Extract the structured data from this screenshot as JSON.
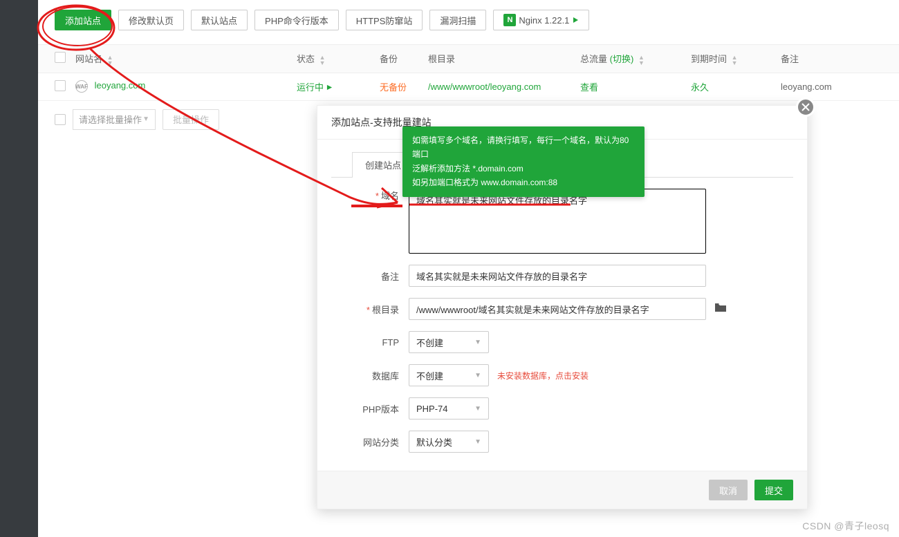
{
  "toolbar": {
    "add_site": "添加站点",
    "edit_default": "修改默认页",
    "default_site": "默认站点",
    "php_cli": "PHP命令行版本",
    "https_defense": "HTTPS防窜站",
    "vuln_scan": "漏洞扫描",
    "nginx": "Nginx 1.22.1"
  },
  "columns": {
    "name": "网站名",
    "status": "状态",
    "backup": "备份",
    "root": "根目录",
    "traffic_prefix": "总流量",
    "traffic_switch": "(切换)",
    "expire": "到期时间",
    "remark": "备注"
  },
  "row": {
    "name": "leoyang.com",
    "status": "运行中",
    "backup": "无备份",
    "root": "/www/wwwroot/leoyang.com",
    "traffic": "查看",
    "expire": "永久",
    "remark": "leoyang.com"
  },
  "batch": {
    "placeholder": "请选择批量操作",
    "action": "批量操作"
  },
  "modal": {
    "title": "添加站点-支持批量建站",
    "tab": "创建站点",
    "tooltip": {
      "l1": "如需填写多个域名，请换行填写，每行一个域名，默认为80端口",
      "l2": "泛解析添加方法 *.domain.com",
      "l3": "如另加端口格式为 www.domain.com:88"
    },
    "labels": {
      "domain": "域名",
      "remark": "备注",
      "root": "根目录",
      "ftp": "FTP",
      "db": "数据库",
      "php": "PHP版本",
      "category": "网站分类"
    },
    "values": {
      "domain": "域名其实就是未来网站文件存放的目录名字",
      "remark": "域名其实就是未来网站文件存放的目录名字",
      "root": "/www/wwwroot/域名其实就是未来网站文件存放的目录名字",
      "ftp": "不创建",
      "db": "不创建",
      "db_warn": "未安装数据库，点击安装",
      "php": "PHP-74",
      "category": "默认分类"
    },
    "footer": {
      "cancel": "取消",
      "submit": "提交"
    }
  },
  "watermark": "CSDN @青子leosq"
}
